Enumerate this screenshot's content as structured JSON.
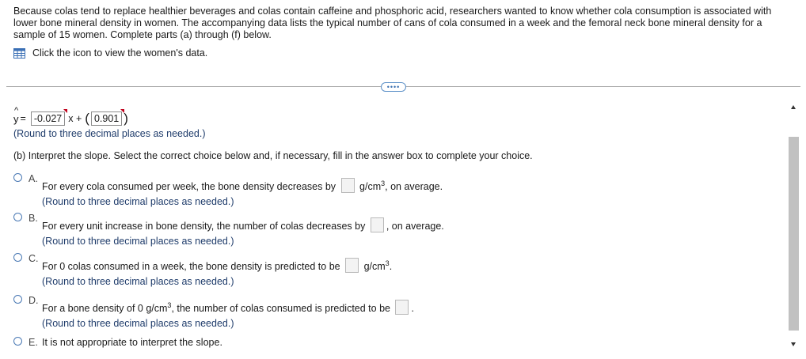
{
  "problem": {
    "intro": "Because colas tend to replace healthier beverages and colas contain caffeine and phosphoric acid, researchers wanted to know whether cola consumption is associated with lower bone mineral density in women. The accompanying data lists the typical number of cans of cola consumed in a week and the femoral neck bone mineral density for a sample of 15 women. Complete parts (a) through (f) below.",
    "data_link_label": "Click the icon to view the women's data.",
    "expand_label": "••••"
  },
  "equation": {
    "lhs": "y",
    "eq": "=",
    "slope_value": "-0.027",
    "x_plus": "x +",
    "intercept_value": "0.901",
    "round_hint": "(Round to three decimal places as needed.)"
  },
  "part_b": {
    "prompt": "(b) Interpret the slope. Select the correct choice below and, if necessary, fill in the answer box to complete your choice.",
    "options": [
      {
        "letter": "A.",
        "pre": "For every cola consumed per week, the bone density decreases by",
        "post": "g/cm",
        "sup": "3",
        "post2": ", on average.",
        "hint": "(Round to three decimal places as needed.)"
      },
      {
        "letter": "B.",
        "pre": "For every unit increase in bone density, the number of colas decreases by",
        "post": ", on average.",
        "hint": "(Round to three decimal places as needed.)"
      },
      {
        "letter": "C.",
        "pre": "For 0 colas consumed in a week, the bone density is predicted to be",
        "post": "g/cm",
        "sup": "3",
        "post2": ".",
        "hint": "(Round to three decimal places as needed.)"
      },
      {
        "letter": "D.",
        "pre": "For a bone density of 0 g/cm",
        "sup": "3",
        "mid": ", the number of colas consumed is predicted to be",
        "post": ".",
        "hint": "(Round to three decimal places as needed.)"
      },
      {
        "letter": "E.",
        "pre": "It is not appropriate to interpret the slope."
      }
    ]
  }
}
